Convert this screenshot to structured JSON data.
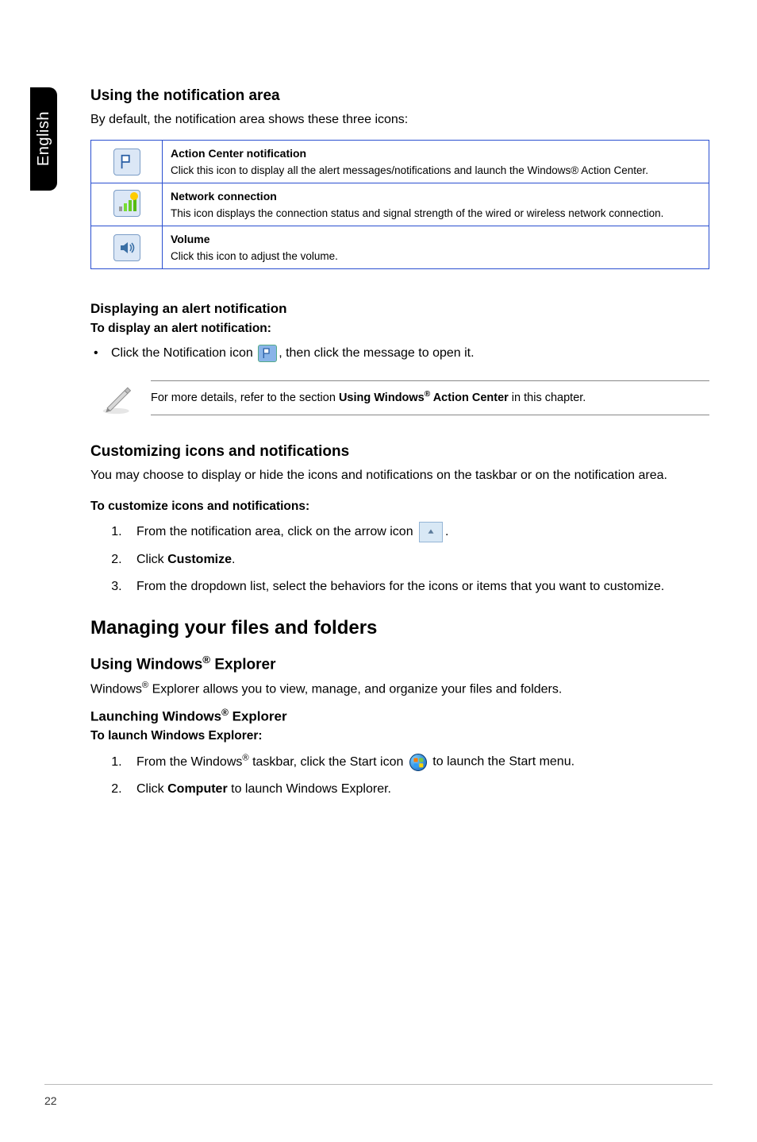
{
  "sidetab": "English",
  "s1": {
    "heading": "Using the notification area",
    "intro": "By default, the notification area shows these three icons:",
    "rows": [
      {
        "title": "Action Center notification",
        "desc": "Click this icon to display all the alert messages/notifications and launch the Windows® Action Center."
      },
      {
        "title": "Network connection",
        "desc": "This icon displays the connection status and signal strength of the wired or wireless network connection."
      },
      {
        "title": "Volume",
        "desc": "Click this icon to adjust the volume."
      }
    ]
  },
  "s2": {
    "heading": "Displaying an alert notification",
    "sub": "To display an alert notification:",
    "bullet_pre": "Click the Notification icon ",
    "bullet_post": ", then click the message to open it."
  },
  "note": {
    "pre": "For more details, refer to the section ",
    "bold": "Using Windows® Action Center",
    "post": " in this chapter."
  },
  "s3": {
    "heading": "Customizing icons and notifications",
    "intro": "You may choose to display or hide the icons and notifications on the taskbar or on the notification area.",
    "sub": "To customize icons and notifications:",
    "step1_pre": "From the notification area, click on the arrow icon ",
    "step1_post": ".",
    "step2_pre": "Click ",
    "step2_bold": "Customize",
    "step2_post": ".",
    "step3": "From the dropdown list, select the behaviors for the icons or items that you want to customize."
  },
  "s4": {
    "big": "Managing your files and folders",
    "h1": "Using Windows® Explorer",
    "p1": "Windows® Explorer allows you to view, manage, and organize your files and folders.",
    "h2": "Launching Windows® Explorer",
    "sub": "To launch Windows Explorer:",
    "step1_pre": "From the Windows® taskbar, click the Start icon ",
    "step1_post": " to launch the Start menu.",
    "step2_pre": "Click ",
    "step2_bold": "Computer",
    "step2_post": " to launch Windows Explorer."
  },
  "pagenum": "22"
}
